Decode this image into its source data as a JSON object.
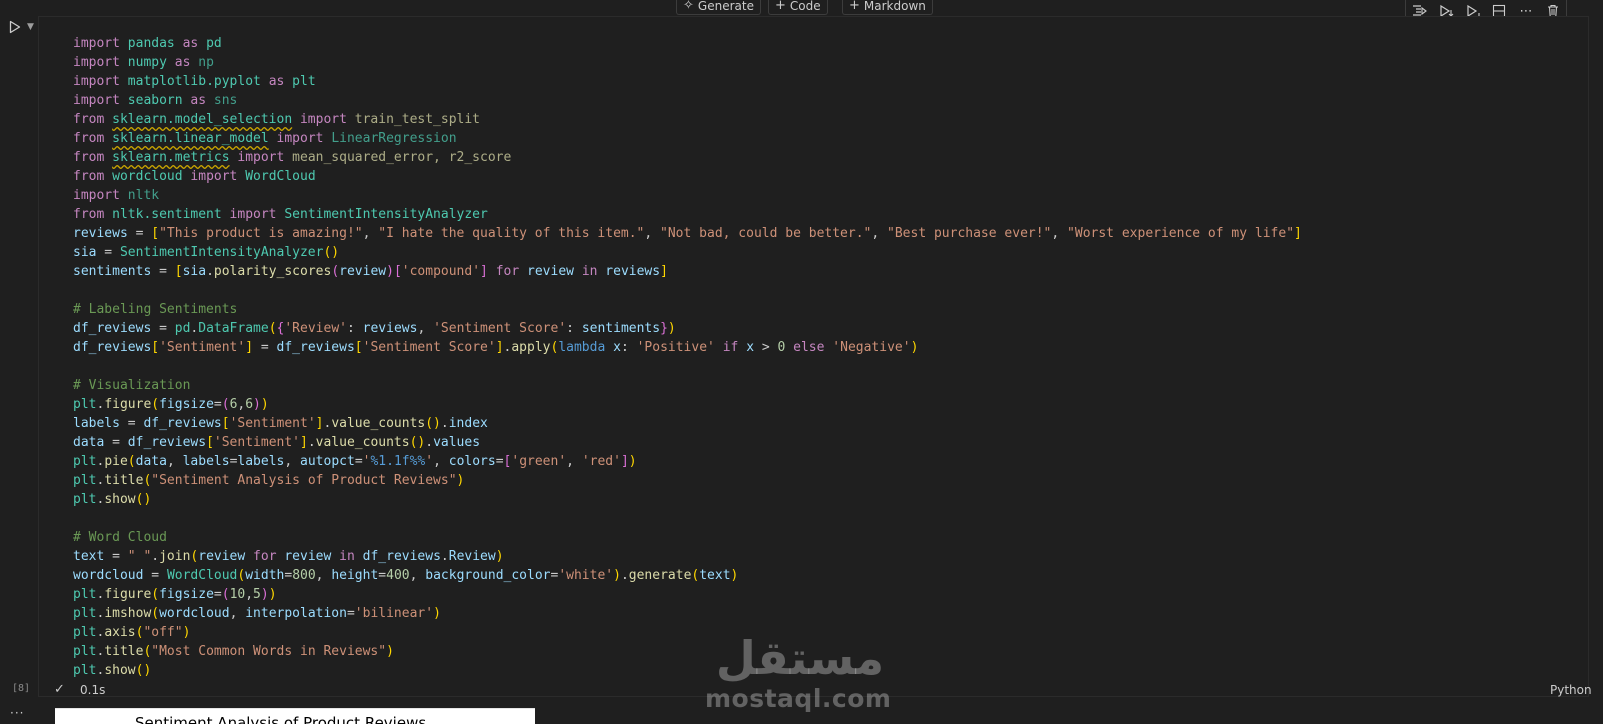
{
  "toolbar": {
    "generate_label": "Generate",
    "code_label": "Code",
    "markdown_label": "Markdown"
  },
  "cell": {
    "execution_count": "[8]",
    "exec_time": "0.1s",
    "language": "Python",
    "code_lines": [
      "import pandas as pd",
      "import numpy as np",
      "import matplotlib.pyplot as plt",
      "import seaborn as sns",
      "from sklearn.model_selection import train_test_split",
      "from sklearn.linear_model import LinearRegression",
      "from sklearn.metrics import mean_squared_error, r2_score",
      "from wordcloud import WordCloud",
      "import nltk",
      "from nltk.sentiment import SentimentIntensityAnalyzer",
      "reviews = [\"This product is amazing!\", \"I hate the quality of this item.\", \"Not bad, could be better.\", \"Best purchase ever!\", \"Worst experience of my life\"]",
      "sia = SentimentIntensityAnalyzer()",
      "sentiments = [sia.polarity_scores(review)['compound'] for review in reviews]",
      "",
      "# Labeling Sentiments",
      "df_reviews = pd.DataFrame({'Review': reviews, 'Sentiment Score': sentiments})",
      "df_reviews['Sentiment'] = df_reviews['Sentiment Score'].apply(lambda x: 'Positive' if x > 0 else 'Negative')",
      "",
      "# Visualization",
      "plt.figure(figsize=(6,6))",
      "labels = df_reviews['Sentiment'].value_counts().index",
      "data = df_reviews['Sentiment'].value_counts().values",
      "plt.pie(data, labels=labels, autopct='%1.1f%%', colors=['green', 'red'])",
      "plt.title(\"Sentiment Analysis of Product Reviews\")",
      "plt.show()",
      "",
      "# Word Cloud",
      "text = \" \".join(review for review in df_reviews.Review)",
      "wordcloud = WordCloud(width=800, height=400, background_color='white').generate(text)",
      "plt.figure(figsize=(10,5))",
      "plt.imshow(wordcloud, interpolation='bilinear')",
      "plt.axis(\"off\")",
      "plt.title(\"Most Common Words in Reviews\")",
      "plt.show()"
    ]
  },
  "output": {
    "title": "Sentiment Analysis of Product Reviews"
  },
  "watermark": {
    "arabic": "مستقل",
    "latin": "mostaql.com"
  },
  "icons": {
    "generate": "sparkle-icon",
    "code": "plus-icon",
    "markdown": "plus-icon",
    "run": "play-icon",
    "run_by_line": "run-by-line-icon",
    "execute_above": "execute-above-icon",
    "execute_below": "execute-below-icon",
    "split_cell": "split-cell-icon",
    "more": "more-icon",
    "delete": "trash-icon",
    "check": "check-icon"
  }
}
